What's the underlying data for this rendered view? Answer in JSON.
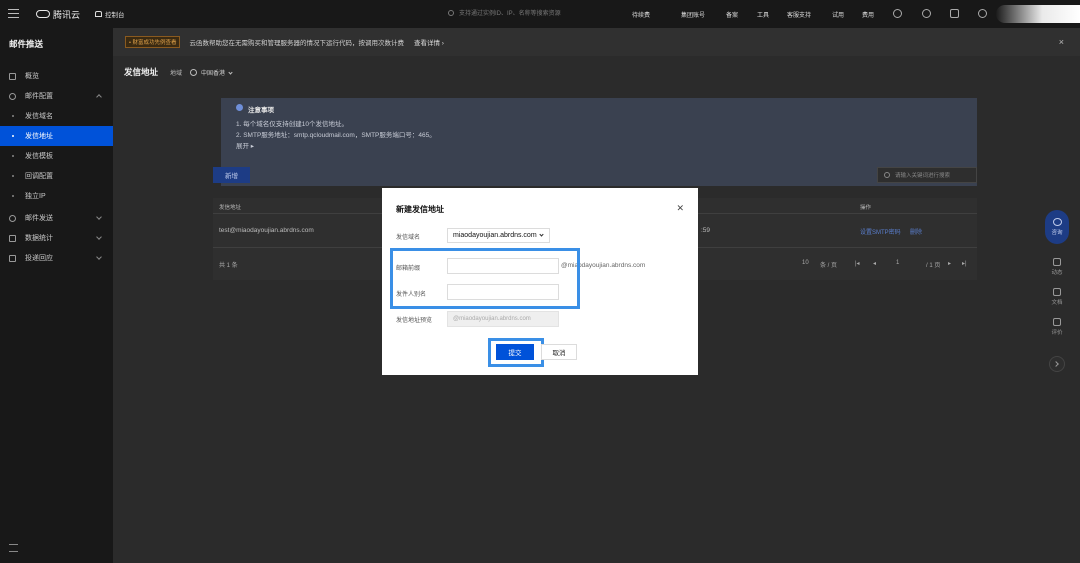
{
  "topbar": {
    "brand": "腾讯云",
    "console": "控制台",
    "search_placeholder": "支持通过实例ID、IP、名称等搜索资源",
    "nav": [
      "待续费",
      "集团账号",
      "备案",
      "工具",
      "客服支持",
      "试用",
      "费用"
    ]
  },
  "sidebar": {
    "title": "邮件推送",
    "items": [
      {
        "label": "概览"
      },
      {
        "label": "邮件配置"
      },
      {
        "label": "发信域名"
      },
      {
        "label": "发信地址"
      },
      {
        "label": "发信模板"
      },
      {
        "label": "回调配置"
      },
      {
        "label": "独立IP"
      },
      {
        "label": "邮件发送"
      },
      {
        "label": "数据统计"
      },
      {
        "label": "投递回应"
      }
    ]
  },
  "notice": {
    "tag": "• 财富成功先例查看",
    "text": "云函数帮助您在无需购买和管理服务器的情况下运行代码，按调用次数计费",
    "more": "查看详情 ›"
  },
  "page": {
    "title": "发信地址",
    "region_label": "地域",
    "region": "中国香港"
  },
  "tips": {
    "title": "注意事项",
    "lines": [
      "1. 每个域名仅支持创建10个发信地址。",
      "2. SMTP服务地址：smtp.qcloudmail.com，SMTP服务端口号：465。"
    ],
    "expand": "展开 ▸"
  },
  "toolbar": {
    "new_label": "新增",
    "search_placeholder": "请输入关键词进行搜索"
  },
  "table": {
    "columns": [
      "发信地址",
      "操作"
    ],
    "rows": [
      {
        "address": "test@miaodayoujian.abrdns.com",
        "time_fragment": ":59",
        "actions": [
          "设置SMTP密码",
          "删除"
        ]
      }
    ],
    "total": "共 1 条",
    "page_size": "10",
    "per_page": "条 / 页",
    "page_current": "1",
    "page_total": "/ 1 页"
  },
  "float": {
    "main": "咨询",
    "items": [
      "动态",
      "文档",
      "评价"
    ]
  },
  "modal": {
    "title": "新建发信地址",
    "domain_label": "发信域名",
    "domain_value": "miaodayoujian.abrdns.com",
    "prefix_label": "邮箱前缀",
    "prefix_value": "",
    "suffix": "@miaodayoujian.abrdns.com",
    "sender_label": "发件人别名",
    "sender_value": "",
    "preview_label": "发信地址预览",
    "preview_value": "@miaodayoujian.abrdns.com",
    "submit": "提交",
    "cancel": "取消"
  },
  "colors": {
    "primary": "#0052d9",
    "highlight": "#3a8fe6",
    "sidebar_bg": "#181818"
  }
}
